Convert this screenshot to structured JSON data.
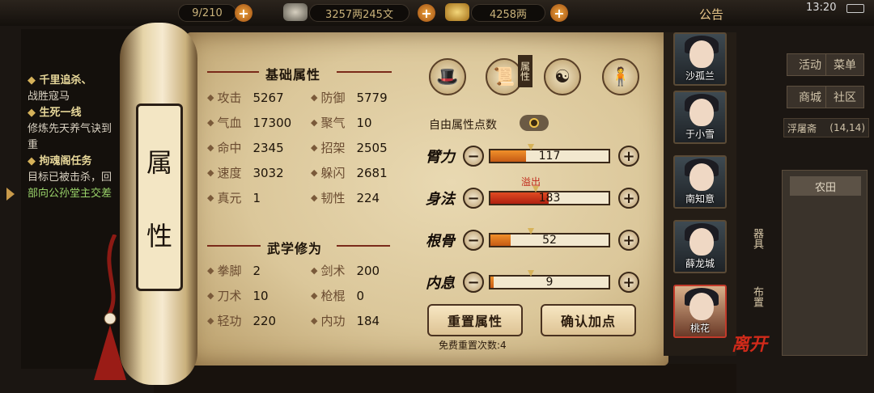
{
  "topbar": {
    "resource1": "9/210",
    "silver": "3257两245文",
    "gold": "4258两",
    "notice": "公告",
    "time": "13:20"
  },
  "quest": {
    "lines": [
      {
        "t": "千里追杀、",
        "kind": "hd"
      },
      {
        "t": "战胜寇马",
        "kind": "txt"
      },
      {
        "t": "生死一线",
        "kind": "hd"
      },
      {
        "t": "修炼先天养气诀到",
        "kind": "txt"
      },
      {
        "t": "重",
        "kind": "txt"
      },
      {
        "t": "拘魂阁任务",
        "kind": "hd"
      },
      {
        "t": "目标已被击杀，回",
        "kind": "txt"
      },
      {
        "t": "部向公孙堂主交差",
        "kind": "green"
      }
    ]
  },
  "right_menu": {
    "b1": "活动",
    "b2": "菜单",
    "b3": "商城",
    "b4": "社区",
    "location": "浮屠斋",
    "coords": "(14,14)",
    "field": "农田",
    "side1": "器具",
    "side2": "布置"
  },
  "scroll_title": {
    "c1": "属",
    "c2": "性"
  },
  "basic": {
    "title": "基础属性",
    "stats": [
      {
        "k": "攻击",
        "v": "5267"
      },
      {
        "k": "防御",
        "v": "5779"
      },
      {
        "k": "气血",
        "v": "17300"
      },
      {
        "k": "聚气",
        "v": "10"
      },
      {
        "k": "命中",
        "v": "2345"
      },
      {
        "k": "招架",
        "v": "2505"
      },
      {
        "k": "速度",
        "v": "3032"
      },
      {
        "k": "躲闪",
        "v": "2681"
      },
      {
        "k": "真元",
        "v": "1"
      },
      {
        "k": "韧性",
        "v": "224"
      }
    ]
  },
  "martial": {
    "title": "武学修为",
    "stats": [
      {
        "k": "拳脚",
        "v": "2"
      },
      {
        "k": "剑术",
        "v": "200"
      },
      {
        "k": "刀术",
        "v": "10"
      },
      {
        "k": "枪棍",
        "v": "0"
      },
      {
        "k": "轻功",
        "v": "220"
      },
      {
        "k": "内功",
        "v": "184"
      }
    ]
  },
  "tabs": {
    "attr_label": "属性"
  },
  "free_points": {
    "label": "自由属性点数",
    "value": "0"
  },
  "attributes": [
    {
      "name": "臂力",
      "value": "117",
      "fill": 0.3,
      "marker": 0.32,
      "overflow": ""
    },
    {
      "name": "身法",
      "value": "183",
      "fill": 0.49,
      "marker": 0.36,
      "overflow": "溢出"
    },
    {
      "name": "根骨",
      "value": "52",
      "fill": 0.17,
      "marker": 0.32,
      "overflow": ""
    },
    {
      "name": "内息",
      "value": "9",
      "fill": 0.03,
      "marker": 0.32,
      "overflow": ""
    }
  ],
  "buttons": {
    "reset": "重置属性",
    "confirm": "确认加点",
    "free_reset": "免费重置次数:4"
  },
  "characters": [
    {
      "name": "沙孤兰"
    },
    {
      "name": "于小雪"
    },
    {
      "name": "南知意"
    },
    {
      "name": "薛龙城"
    },
    {
      "name": "桃花"
    }
  ],
  "leave": "离开",
  "colors": {
    "accent": "#c55a14",
    "overflow": "#c0281a",
    "bar_red": "#e04a22"
  }
}
